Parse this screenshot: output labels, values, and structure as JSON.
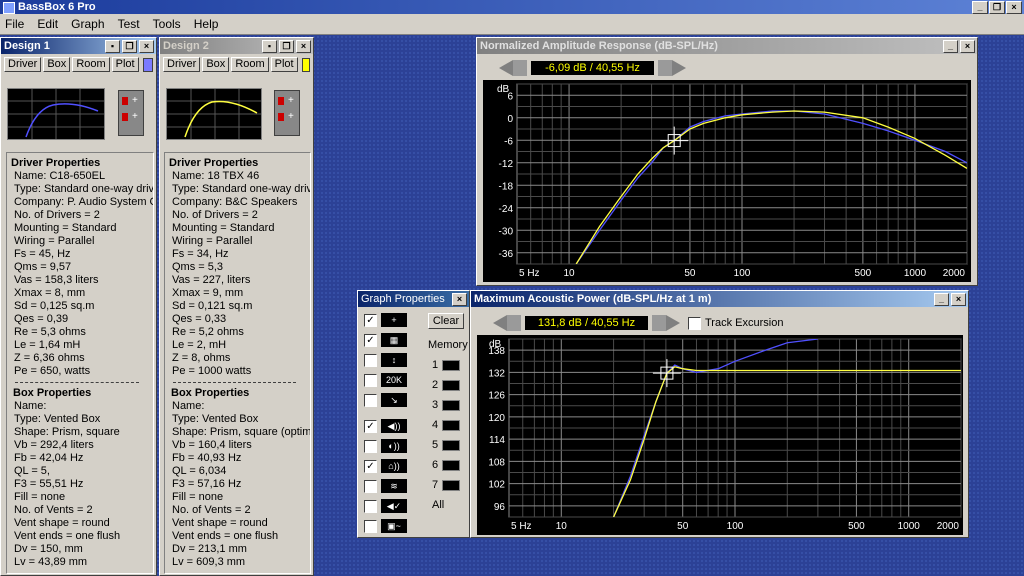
{
  "app": {
    "title": "BassBox 6 Pro"
  },
  "menu": [
    "File",
    "Edit",
    "Graph",
    "Test",
    "Tools",
    "Help"
  ],
  "designs": [
    {
      "title": "Design 1",
      "active": true,
      "tabs": [
        "Driver",
        "Box",
        "Room",
        "Plot"
      ],
      "swatch_color": "#7b7bff",
      "curve_color": "#5050ff",
      "driver_header": "Driver Properties",
      "driver": [
        "Name: C18-650EL",
        "Type: Standard one-way driver",
        "Company: P. Audio System Co.",
        "No. of Drivers = 2",
        "Mounting = Standard",
        "Wiring = Parallel",
        "Fs = 45, Hz",
        "Qms = 9,57",
        "Vas = 158,3 liters",
        "Xmax = 8, mm",
        "Sd = 0,125 sq.m",
        "Qes = 0,39",
        "Re = 5,3 ohms",
        "Le = 1,64 mH",
        "Z = 6,36 ohms",
        "Pe = 650, watts"
      ],
      "box_header": "Box Properties",
      "box": [
        "Name:",
        "Type: Vented Box",
        "Shape: Prism, square",
        "Vb = 292,4 liters",
        "Fb = 42,04 Hz",
        "QL = 5,",
        "F3 = 55,51 Hz",
        "Fill = none",
        "No. of Vents = 2",
        "Vent shape = round",
        "Vent ends = one flush",
        "Dv = 150, mm",
        "Lv = 43,89 mm"
      ]
    },
    {
      "title": "Design 2",
      "active": false,
      "tabs": [
        "Driver",
        "Box",
        "Room",
        "Plot"
      ],
      "swatch_color": "#ffff00",
      "curve_color": "#ffff40",
      "driver_header": "Driver Properties",
      "driver": [
        "Name: 18 TBX 46",
        "Type: Standard one-way driver",
        "Company: B&C Speakers",
        "No. of Drivers = 2",
        "Mounting = Standard",
        "Wiring = Parallel",
        "Fs = 34, Hz",
        "Qms = 5,3",
        "Vas = 227, liters",
        "Xmax = 9, mm",
        "Sd = 0,121 sq.m",
        "Qes = 0,33",
        "Re = 5,2 ohms",
        "Le = 2, mH",
        "Z = 8, ohms",
        "Pe = 1000 watts"
      ],
      "box_header": "Box Properties",
      "box": [
        "Name:",
        "Type: Vented Box",
        "Shape: Prism, square (optimum)",
        "Vb = 160,4 liters",
        "Fb = 40,93 Hz",
        "QL = 6,034",
        "F3 = 57,16 Hz",
        "Fill = none",
        "No. of Vents = 2",
        "Vent shape = round",
        "Vent ends = one flush",
        "Dv = 213,1 mm",
        "Lv = 609,3 mm"
      ]
    }
  ],
  "graph_props": {
    "title": "Graph Properties",
    "clear": "Clear",
    "memory_label": "Memory",
    "memory_slots": [
      "1",
      "2",
      "3",
      "4",
      "5",
      "6",
      "7"
    ],
    "all_label": "All",
    "items": [
      {
        "checked": true,
        "icon": "crosshair-icon",
        "glyph": "+"
      },
      {
        "checked": true,
        "icon": "grid-icon",
        "glyph": "▦"
      },
      {
        "checked": false,
        "icon": "vertical-scale-icon",
        "glyph": "↕"
      },
      {
        "checked": false,
        "icon": "range-20k-icon",
        "glyph": "20K"
      },
      {
        "checked": false,
        "icon": "arrow-icon",
        "glyph": "↘"
      },
      {
        "checked": true,
        "icon": "speaker-sound-icon",
        "glyph": "◀))"
      },
      {
        "checked": false,
        "icon": "cone-icon",
        "glyph": "◐))"
      },
      {
        "checked": true,
        "icon": "room-icon",
        "glyph": "⌂))"
      },
      {
        "checked": false,
        "icon": "filter-icon",
        "glyph": "≋"
      },
      {
        "checked": false,
        "icon": "speaker-graph-icon",
        "glyph": "◀✓"
      },
      {
        "checked": false,
        "icon": "meter-icon",
        "glyph": "▣~"
      }
    ]
  },
  "graphs": [
    {
      "title": "Normalized Amplitude Response (dB-SPL/Hz)",
      "readout": "-6,09 dB / 40,55 Hz",
      "yunit": "dB",
      "yticks": [
        "6",
        "0",
        "-6",
        "-12",
        "-18",
        "-24",
        "-30",
        "-36"
      ],
      "xticks": [
        "5 Hz",
        "10",
        "50",
        "100",
        "500",
        "1000",
        "2000"
      ]
    },
    {
      "title": "Maximum Acoustic Power (dB-SPL/Hz at 1 m)",
      "readout": "131,8 dB / 40,55 Hz",
      "track_label": "Track Excursion",
      "yunit": "dB",
      "yticks": [
        "138",
        "132",
        "126",
        "120",
        "114",
        "108",
        "102",
        "96"
      ],
      "xticks": [
        "5 Hz",
        "10",
        "50",
        "100",
        "500",
        "1000",
        "2000"
      ]
    }
  ],
  "chart_data": [
    {
      "type": "line",
      "title": "Normalized Amplitude Response (dB-SPL/Hz)",
      "xlabel": "Hz",
      "ylabel": "dB",
      "xscale": "log",
      "xlim": [
        5,
        2000
      ],
      "ylim": [
        -39,
        9
      ],
      "grid": true,
      "cursor": {
        "x": 40.55,
        "y": -6.09
      },
      "series": [
        {
          "name": "Design 1",
          "color": "#5050ff",
          "x": [
            11,
            15,
            20,
            25,
            30,
            35,
            40.55,
            50,
            60,
            80,
            100,
            150,
            200,
            300,
            500,
            700,
            1000,
            1500,
            2000
          ],
          "y": [
            -39,
            -30,
            -22,
            -16,
            -12,
            -8,
            -6.09,
            -2.5,
            -1,
            0.5,
            1,
            1.8,
            1.8,
            1,
            -1.5,
            -3.5,
            -6,
            -9,
            -12
          ]
        },
        {
          "name": "Design 2",
          "color": "#ffff40",
          "x": [
            11,
            15,
            20,
            25,
            30,
            35,
            40.55,
            50,
            60,
            80,
            100,
            150,
            200,
            300,
            500,
            700,
            1000,
            1500,
            2000
          ],
          "y": [
            -39,
            -29,
            -21,
            -15,
            -11,
            -8,
            -6.09,
            -3,
            -1.5,
            0,
            0.8,
            1.5,
            1.8,
            1.5,
            0,
            -2.5,
            -5.5,
            -10,
            -13.5
          ]
        }
      ]
    },
    {
      "type": "line",
      "title": "Maximum Acoustic Power (dB-SPL/Hz at 1 m)",
      "xlabel": "Hz",
      "ylabel": "dB",
      "xscale": "log",
      "xlim": [
        5,
        2000
      ],
      "ylim": [
        93,
        141
      ],
      "grid": true,
      "cursor": {
        "x": 40.55,
        "y": 131.8
      },
      "series": [
        {
          "name": "Design 1",
          "color": "#5050ff",
          "x": [
            20,
            25,
            30,
            35,
            40.55,
            45,
            50,
            60,
            80,
            100,
            150,
            200,
            300
          ],
          "y": [
            93,
            104,
            115,
            124,
            131.8,
            134,
            133,
            132,
            133,
            135,
            138,
            140,
            141
          ]
        },
        {
          "name": "Design 2",
          "color": "#ffff40",
          "x": [
            20,
            25,
            30,
            35,
            40.55,
            45,
            50,
            60,
            80,
            100,
            200,
            500,
            1000,
            2000
          ],
          "y": [
            93,
            103,
            114,
            124,
            131.8,
            133.5,
            133,
            132.5,
            132.5,
            132.5,
            132.5,
            132.5,
            132.5,
            132.5
          ]
        }
      ]
    }
  ]
}
